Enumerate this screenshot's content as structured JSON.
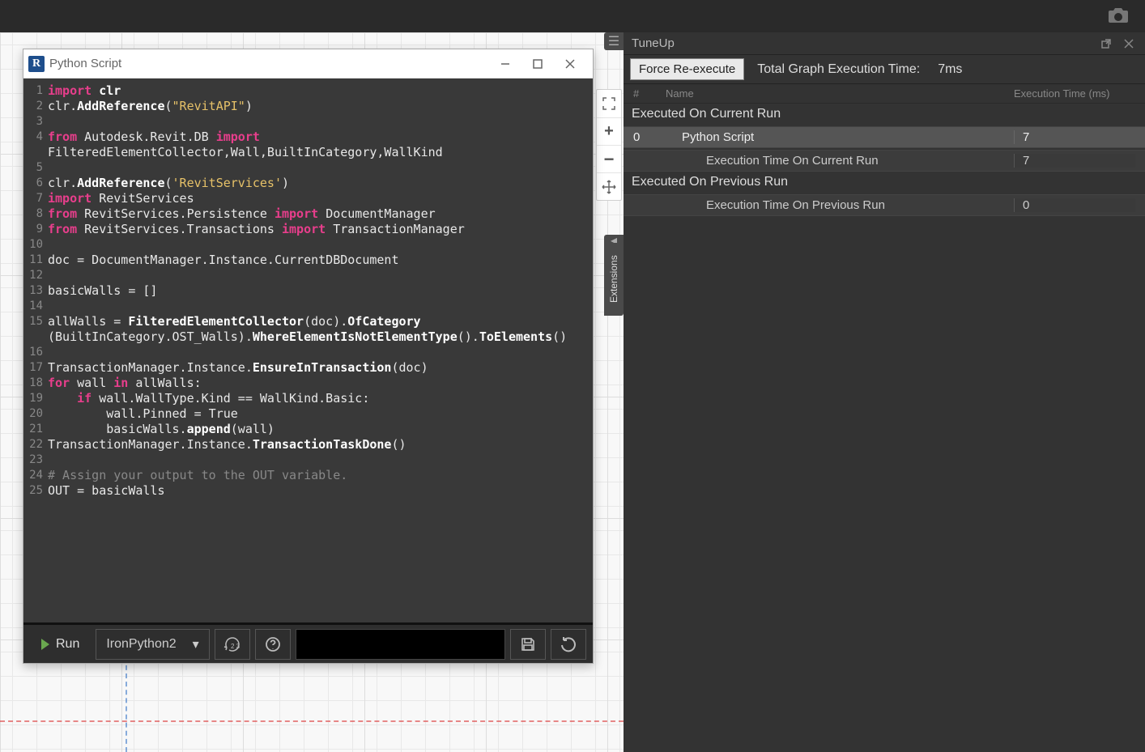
{
  "topbar": {
    "camera_icon": "camera-icon"
  },
  "editor": {
    "window_title": "Python Script",
    "run_btn": "Run",
    "engine": "IronPython2",
    "code_lines": [
      {
        "n": 1,
        "tokens": [
          [
            "kw",
            "import"
          ],
          [
            "",
            ""
          ],
          [
            "fn",
            "clr"
          ]
        ]
      },
      {
        "n": 2,
        "tokens": [
          [
            "",
            "clr."
          ],
          [
            "fn",
            "AddReference"
          ],
          [
            "",
            "("
          ],
          [
            "str",
            "\"RevitAPI\""
          ],
          [
            "",
            ")"
          ]
        ]
      },
      {
        "n": 3,
        "tokens": []
      },
      {
        "n": 4,
        "tokens": [
          [
            "kw",
            "from"
          ],
          [
            "",
            ""
          ],
          [
            "",
            "Autodesk.Revit.DB "
          ],
          [
            "kw",
            "import"
          ]
        ]
      },
      {
        "n": "",
        "tokens": [
          [
            "",
            "FilteredElementCollector,Wall,BuiltInCategory,WallKind"
          ]
        ]
      },
      {
        "n": 5,
        "tokens": []
      },
      {
        "n": 6,
        "tokens": [
          [
            "",
            "clr."
          ],
          [
            "fn",
            "AddReference"
          ],
          [
            "",
            "("
          ],
          [
            "str",
            "'RevitServices'"
          ],
          [
            "",
            ")"
          ]
        ]
      },
      {
        "n": 7,
        "tokens": [
          [
            "kw",
            "import"
          ],
          [
            "",
            ""
          ],
          [
            "",
            "RevitServices"
          ]
        ]
      },
      {
        "n": 8,
        "tokens": [
          [
            "kw",
            "from"
          ],
          [
            "",
            ""
          ],
          [
            "",
            "RevitServices.Persistence "
          ],
          [
            "kw",
            "import"
          ],
          [
            "",
            ""
          ],
          [
            "",
            "DocumentManager"
          ]
        ]
      },
      {
        "n": 9,
        "tokens": [
          [
            "kw",
            "from"
          ],
          [
            "",
            ""
          ],
          [
            "",
            "RevitServices.Transactions "
          ],
          [
            "kw",
            "import"
          ],
          [
            "",
            ""
          ],
          [
            "",
            "TransactionManager"
          ]
        ]
      },
      {
        "n": 10,
        "tokens": []
      },
      {
        "n": 11,
        "tokens": [
          [
            "",
            "doc = DocumentManager.Instance.CurrentDBDocument"
          ]
        ]
      },
      {
        "n": 12,
        "tokens": []
      },
      {
        "n": 13,
        "tokens": [
          [
            "",
            "basicWalls = []"
          ]
        ]
      },
      {
        "n": 14,
        "tokens": []
      },
      {
        "n": 15,
        "tokens": [
          [
            "",
            "allWalls = "
          ],
          [
            "fn",
            "FilteredElementCollector"
          ],
          [
            "",
            "(doc)."
          ],
          [
            "fn",
            "OfCategory"
          ]
        ]
      },
      {
        "n": "",
        "tokens": [
          [
            "",
            "(BuiltInCategory.OST_Walls)."
          ],
          [
            "fn",
            "WhereElementIsNotElementType"
          ],
          [
            "",
            "()."
          ],
          [
            "fn",
            "ToElements"
          ],
          [
            "",
            "()"
          ]
        ]
      },
      {
        "n": 16,
        "tokens": []
      },
      {
        "n": 17,
        "tokens": [
          [
            "",
            "TransactionManager.Instance."
          ],
          [
            "fn",
            "EnsureInTransaction"
          ],
          [
            "",
            "(doc)"
          ]
        ]
      },
      {
        "n": 18,
        "tokens": [
          [
            "kw",
            "for"
          ],
          [
            "",
            ""
          ],
          [
            "",
            "wall "
          ],
          [
            "kw",
            "in"
          ],
          [
            "",
            ""
          ],
          [
            "",
            "allWalls:"
          ]
        ]
      },
      {
        "n": 19,
        "tokens": [
          [
            "",
            "    "
          ],
          [
            "kw",
            "if"
          ],
          [
            "",
            ""
          ],
          [
            "",
            "wall.WallType.Kind == WallKind.Basic:"
          ]
        ]
      },
      {
        "n": 20,
        "tokens": [
          [
            "",
            "        wall.Pinned = True"
          ]
        ]
      },
      {
        "n": 21,
        "tokens": [
          [
            "",
            "        basicWalls."
          ],
          [
            "fn",
            "append"
          ],
          [
            "",
            "(wall)"
          ]
        ]
      },
      {
        "n": 22,
        "tokens": [
          [
            "",
            "TransactionManager.Instance."
          ],
          [
            "fn",
            "TransactionTaskDone"
          ],
          [
            "",
            "()"
          ]
        ]
      },
      {
        "n": 23,
        "tokens": []
      },
      {
        "n": 24,
        "tokens": [
          [
            "cm",
            "# Assign your output to the OUT variable."
          ]
        ]
      },
      {
        "n": 25,
        "tokens": [
          [
            "",
            "OUT = basicWalls"
          ]
        ]
      }
    ]
  },
  "tuneup": {
    "title": "TuneUp",
    "force_btn": "Force Re-execute",
    "total_label": "Total Graph Execution Time:",
    "total_time": "7ms",
    "header_idx": "#",
    "header_name": "Name",
    "header_time": "Execution Time (ms)",
    "section_current": "Executed On Current Run",
    "rows_current": [
      {
        "idx": "0",
        "name": "Python Script",
        "time": "7",
        "selected": true
      },
      {
        "idx": "",
        "name": "Execution Time On Current Run",
        "time": "7",
        "sub": true
      }
    ],
    "section_prev": "Executed On Previous Run",
    "rows_prev": [
      {
        "idx": "",
        "name": "Execution Time On Previous Run",
        "time": "0",
        "sub": true
      }
    ]
  },
  "extensions_tab": "Extensions"
}
